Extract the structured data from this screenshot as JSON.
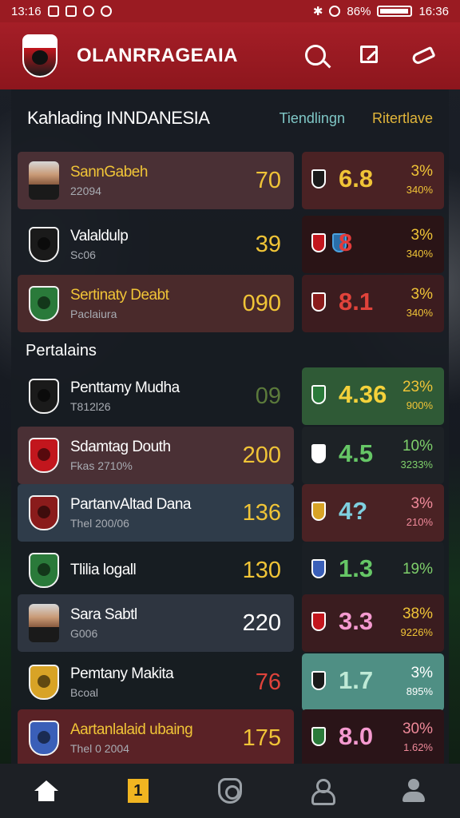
{
  "status_bar": {
    "time_left": "13:16",
    "battery_percent": "86%",
    "time_right": "16:36"
  },
  "app": {
    "title": "OLANRRAGEAIA"
  },
  "header": {
    "title": "Kahlading INNDANESIA",
    "col1": "Tiendlingn",
    "col2": "Ritertlave"
  },
  "section_label": "Pertalains",
  "colors": {
    "appbar": "#9a1b22",
    "accent_gold": "#e1b53a",
    "accent_teal": "#7fc7c6"
  },
  "rows": [
    {
      "name": "SannGabeh",
      "sub": "22094",
      "score": "70",
      "value": "6.8",
      "pct": "3%",
      "pct2": "340%",
      "avatar": "player-photo",
      "left_bg": "#4a3035",
      "right_bg": "#4a2224",
      "name_color": "#f0c437",
      "score_color": "#f0c437",
      "value_color": "#f0c437",
      "pct_color": "#f0c437"
    },
    {
      "name": "Valaldulp",
      "sub": "Sc06",
      "score": "39",
      "value": "8",
      "pct": "3%",
      "pct2": "340%",
      "avatar": "club-crest",
      "left_bg": "transparent",
      "right_bg": "#2a1416",
      "name_color": "#ffffff",
      "score_color": "#f0c437",
      "value_color": "#e33b3b",
      "pct_color": "#f0c437"
    },
    {
      "name": "Sertinaty Deabt",
      "sub": "Paclaiura",
      "score": "090",
      "value": "8.1",
      "pct": "3%",
      "pct2": "340%",
      "avatar": "club-crest",
      "left_bg": "#4a2a2b",
      "right_bg": "#3c1c1f",
      "name_color": "#f0c437",
      "score_color": "#f0c437",
      "value_color": "#e0433b",
      "pct_color": "#f0c437"
    },
    {
      "name": "Penttamy Mudha",
      "sub": "T812l26",
      "score": "09",
      "value": "4.36",
      "pct": "23%",
      "pct2": "900%",
      "avatar": "club-crest",
      "left_bg": "transparent",
      "right_bg": "#2f5a36",
      "name_color": "#ffffff",
      "score_color": "#5b7a3b",
      "value_color": "#f4d13b",
      "pct_color": "#f0c437"
    },
    {
      "name": "Sdamtag Douth",
      "sub": "Fkas 2710%",
      "score": "200",
      "value": "4.5",
      "pct": "10%",
      "pct2": "3233%",
      "avatar": "club-crest",
      "left_bg": "#4a3035",
      "right_bg": "#1d2226",
      "name_color": "#ffffff",
      "score_color": "#f0c437",
      "value_color": "#66c766",
      "pct_color": "#7fd06b"
    },
    {
      "name": "PartanvAltad Dana",
      "sub": "Thel 200/06",
      "score": "136",
      "value": "4?",
      "pct": "3%",
      "pct2": "210%",
      "avatar": "club-crest",
      "left_bg": "#2f3c4a",
      "right_bg": "#4a2224",
      "name_color": "#ffffff",
      "score_color": "#f0c437",
      "value_color": "#7fd0e0",
      "pct_color": "#f08a9a"
    },
    {
      "name": "Tlilia logall",
      "sub": "",
      "score": "130",
      "value": "1.3",
      "pct": "19%",
      "pct2": "",
      "avatar": "club-crest",
      "left_bg": "transparent",
      "right_bg": "#1a1f24",
      "name_color": "#ffffff",
      "score_color": "#f0c437",
      "value_color": "#66c766",
      "pct_color": "#7fd06b"
    },
    {
      "name": "Sara Sabtl",
      "sub": "G006",
      "score": "220",
      "value": "3.3",
      "pct": "38%",
      "pct2": "9226%",
      "avatar": "player-photo",
      "left_bg": "#2e3540",
      "right_bg": "#3a1c1f",
      "name_color": "#ffffff",
      "score_color": "#ffffff",
      "value_color": "#f59ad0",
      "pct_color": "#f0c437"
    },
    {
      "name": "Pemtany Makita",
      "sub": "Bcoal",
      "score": "76",
      "value": "1.7",
      "pct": "3%",
      "pct2": "895%",
      "avatar": "club-crest",
      "left_bg": "transparent",
      "right_bg": "#4f8f84",
      "name_color": "#ffffff",
      "score_color": "#e0433b",
      "value_color": "#bfe9d6",
      "pct_color": "#ffffff"
    },
    {
      "name": "Aartanlalaid ubaing",
      "sub": "Thel 0 2004",
      "score": "175",
      "value": "8.0",
      "pct": "30%",
      "pct2": "1.62%",
      "avatar": "club-crest",
      "left_bg": "#5a2226",
      "right_bg": "#2a1418",
      "name_color": "#f0c437",
      "score_color": "#f0c437",
      "value_color": "#f59ad0",
      "pct_color": "#f08a9a"
    }
  ],
  "nav": {
    "badge": "1"
  }
}
